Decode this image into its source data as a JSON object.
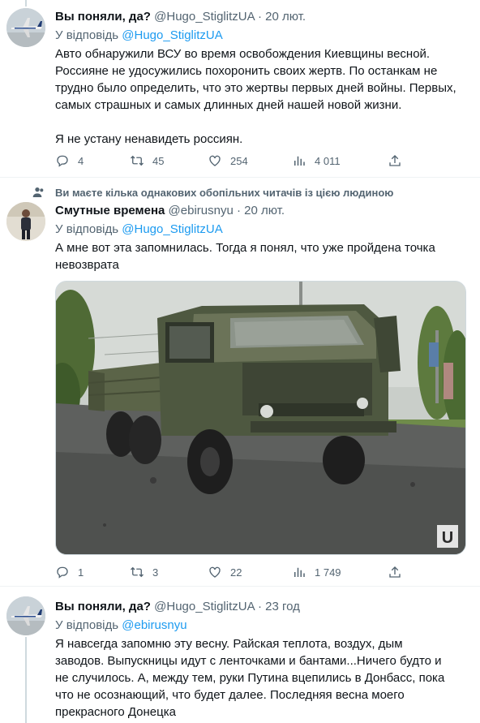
{
  "tweets": [
    {
      "name": "Вы поняли, да?",
      "handle": "@Hugo_StiglitzUA",
      "date": "· 20 лют.",
      "reply_prefix": "У відповідь",
      "reply_to": "@Hugo_StiglitzUA",
      "body": [
        "Авто обнаружили ВСУ во время освобождения Киевщины весной. Россияне не удосужились похоронить своих жертв. По останкам не трудно было определить, что это жертвы первых дней войны. Первых, самых страшных и самых длинных дней нашей новой жизни.",
        "Я не устану ненавидеть россиян."
      ],
      "stats": {
        "replies": "4",
        "retweets": "45",
        "likes": "254",
        "views": "4 011"
      }
    },
    {
      "social_context": "Ви маєте кілька однакових обопільних читачів із цією людиною",
      "name": "Смутные времена",
      "handle": "@ebirusnyu",
      "date": "· 20 лют.",
      "reply_prefix": "У відповідь",
      "reply_to": "@Hugo_StiglitzUA",
      "body": [
        "А мне вот эта запомнилась. Тогда я понял, что уже пройдена точка невозврата"
      ],
      "watermark": "U",
      "stats": {
        "replies": "1",
        "retweets": "3",
        "likes": "22",
        "views": "1 749"
      }
    },
    {
      "name": "Вы поняли, да?",
      "handle": "@Hugo_StiglitzUA",
      "date": "· 23 год",
      "reply_prefix": "У відповідь",
      "reply_to": "@ebirusnyu",
      "body": [
        "Я навсегда запомню эту весну. Райская теплота, воздух, дым заводов. Выпускницы идут с ленточками и бантами...Ничего будто и не случилось. А, между тем, руки Путина вцепились в Донбасс, пока что не осознающий, что будет далее. Последняя весна моего прекрасного Донецка"
      ]
    }
  ]
}
